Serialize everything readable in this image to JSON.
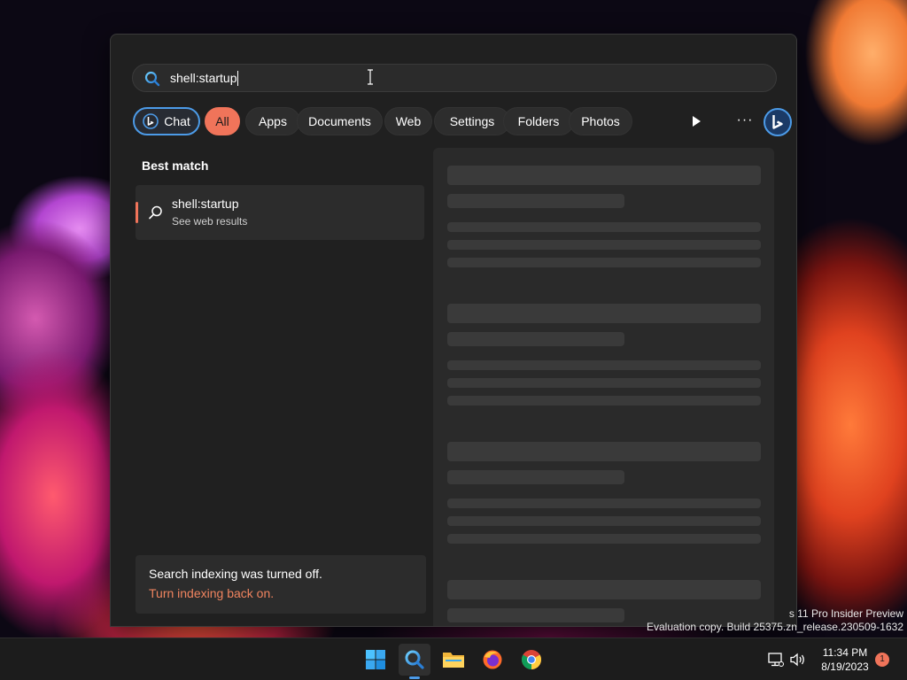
{
  "search": {
    "query": "shell:startup"
  },
  "filters": {
    "chat": "Chat",
    "all": "All",
    "apps": "Apps",
    "documents": "Documents",
    "web": "Web",
    "settings": "Settings",
    "folders": "Folders",
    "photos": "Photos",
    "more": "···"
  },
  "results": {
    "best_match_label": "Best match",
    "items": [
      {
        "title": "shell:startup",
        "subtitle": "See web results",
        "icon": "search-icon"
      }
    ]
  },
  "indexing": {
    "message": "Search indexing was turned off.",
    "link": "Turn indexing back on."
  },
  "watermark": {
    "line1": "s 11 Pro Insider Preview",
    "line2": "Evaluation copy. Build 25375.zn_release.230509-1632"
  },
  "taskbar": {
    "apps": [
      "windows-start",
      "search",
      "file-explorer",
      "firefox",
      "chrome"
    ],
    "active_app": "search",
    "time": "11:34 PM",
    "date": "8/19/2023",
    "notification_count": "1"
  },
  "colors": {
    "accent": "#f0745a",
    "chat_border": "#4c9be8",
    "flyout_bg": "#202020"
  }
}
